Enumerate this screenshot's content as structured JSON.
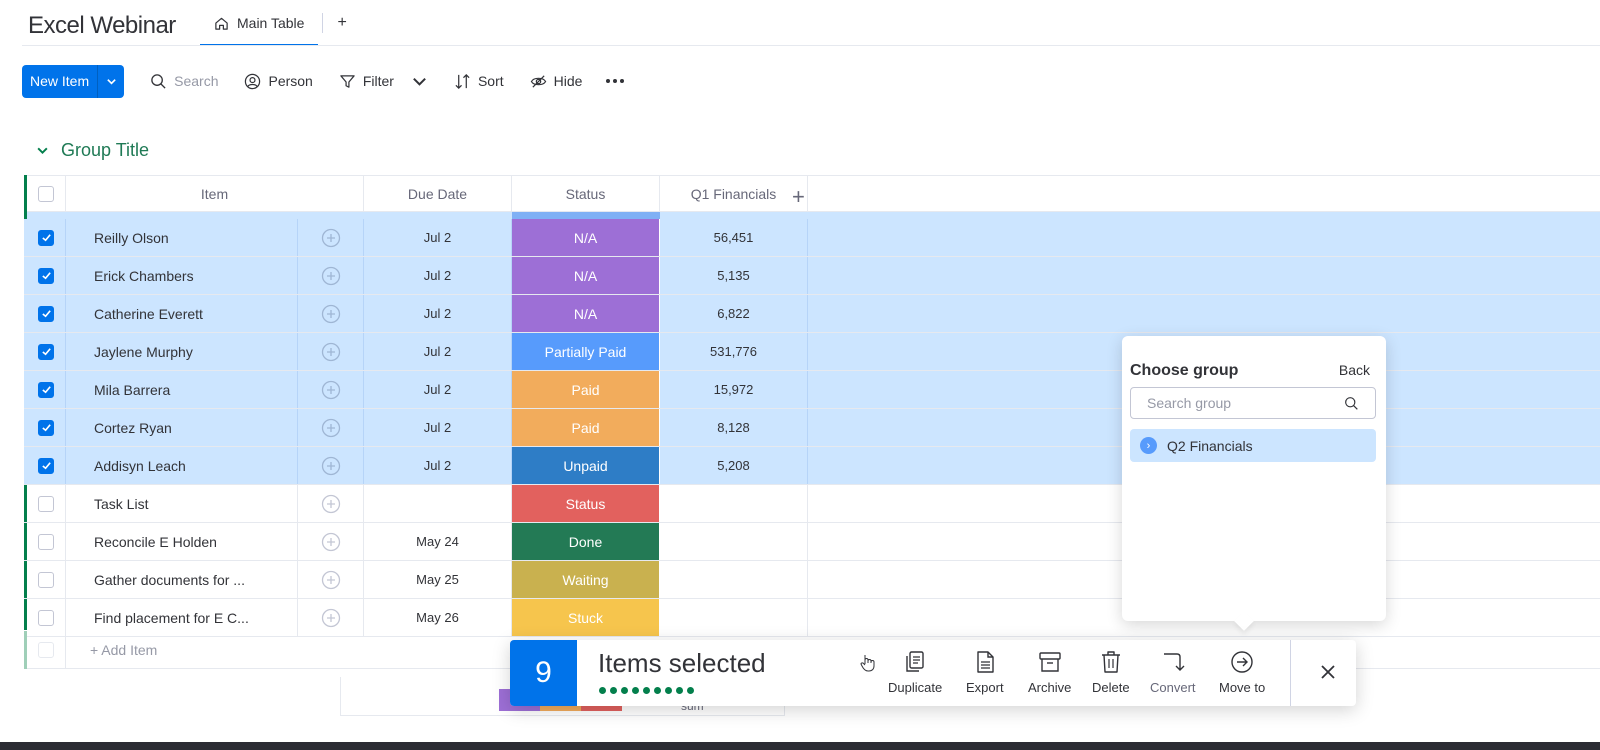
{
  "header": {
    "title": "Excel Webinar",
    "tabs": [
      {
        "label": "Main Table",
        "icon": "home-icon"
      }
    ],
    "add_tab": "+"
  },
  "toolbar": {
    "new_item": "New Item",
    "search": "Search",
    "person": "Person",
    "filter": "Filter",
    "sort": "Sort",
    "hide": "Hide"
  },
  "group": {
    "title": "Group Title",
    "color": "#037f4c"
  },
  "table": {
    "columns": [
      "Item",
      "Due Date",
      "Status",
      "Q1 Financials"
    ],
    "add_column": "+",
    "rows": [
      {
        "name": "Reilly Olson",
        "due": "Jul 2",
        "status": "N/A",
        "status_color": "#9d6fd6",
        "q1": "56,451",
        "selected": true
      },
      {
        "name": "Erick Chambers",
        "due": "Jul 2",
        "status": "N/A",
        "status_color": "#9d6fd6",
        "q1": "5,135",
        "selected": true
      },
      {
        "name": "Catherine Everett",
        "due": "Jul 2",
        "status": "N/A",
        "status_color": "#9d6fd6",
        "q1": "6,822",
        "selected": true
      },
      {
        "name": "Jaylene Murphy",
        "due": "Jul 2",
        "status": "Partially Paid",
        "status_color": "#579bfc",
        "q1": "531,776",
        "selected": true
      },
      {
        "name": "Mila Barrera",
        "due": "Jul 2",
        "status": "Paid",
        "status_color": "#f2ac5c",
        "q1": "15,972",
        "selected": true
      },
      {
        "name": "Cortez Ryan",
        "due": "Jul 2",
        "status": "Paid",
        "status_color": "#f2ac5c",
        "q1": "8,128",
        "selected": true
      },
      {
        "name": "Addisyn Leach",
        "due": "Jul 2",
        "status": "Unpaid",
        "status_color": "#2e7dc6",
        "q1": "5,208",
        "selected": true
      },
      {
        "name": "Task List",
        "due": "",
        "status": "Status",
        "status_color": "#e2615e",
        "q1": "",
        "selected": false
      },
      {
        "name": "Reconcile E Holden",
        "due": "May 24",
        "status": "Done",
        "status_color": "#237a55",
        "q1": "",
        "selected": false
      },
      {
        "name": "Gather documents for ...",
        "due": "May 25",
        "status": "Waiting",
        "status_color": "#c9b14f",
        "q1": "",
        "selected": false
      },
      {
        "name": "Find placement for E C...",
        "due": "May 26",
        "status": "Stuck",
        "status_color": "#f6c54d",
        "q1": "",
        "selected": false
      }
    ],
    "add_item": "+ Add Item",
    "footer_sum": "sum"
  },
  "popover": {
    "title": "Choose group",
    "back": "Back",
    "search_placeholder": "Search group",
    "option": "Q2 Financials"
  },
  "action_bar": {
    "count": "9",
    "label": "Items selected",
    "actions": [
      "Duplicate",
      "Export",
      "Archive",
      "Delete",
      "Convert",
      "Move to"
    ]
  }
}
